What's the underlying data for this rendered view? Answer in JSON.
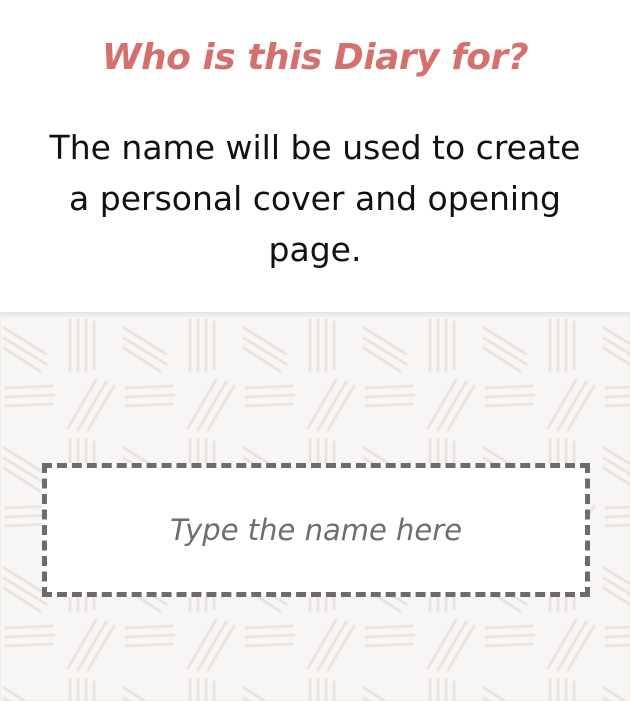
{
  "header": {
    "title": "Who is this Diary for?",
    "description": "The name will be used to create a personal cover and opening page."
  },
  "name_input": {
    "value": "",
    "placeholder": "Type the name here"
  },
  "colors": {
    "title": "#d4706e",
    "pattern_background": "#f8f6f4",
    "pattern_stroke": "#e9e4e1",
    "input_border": "#6c6c6c"
  }
}
